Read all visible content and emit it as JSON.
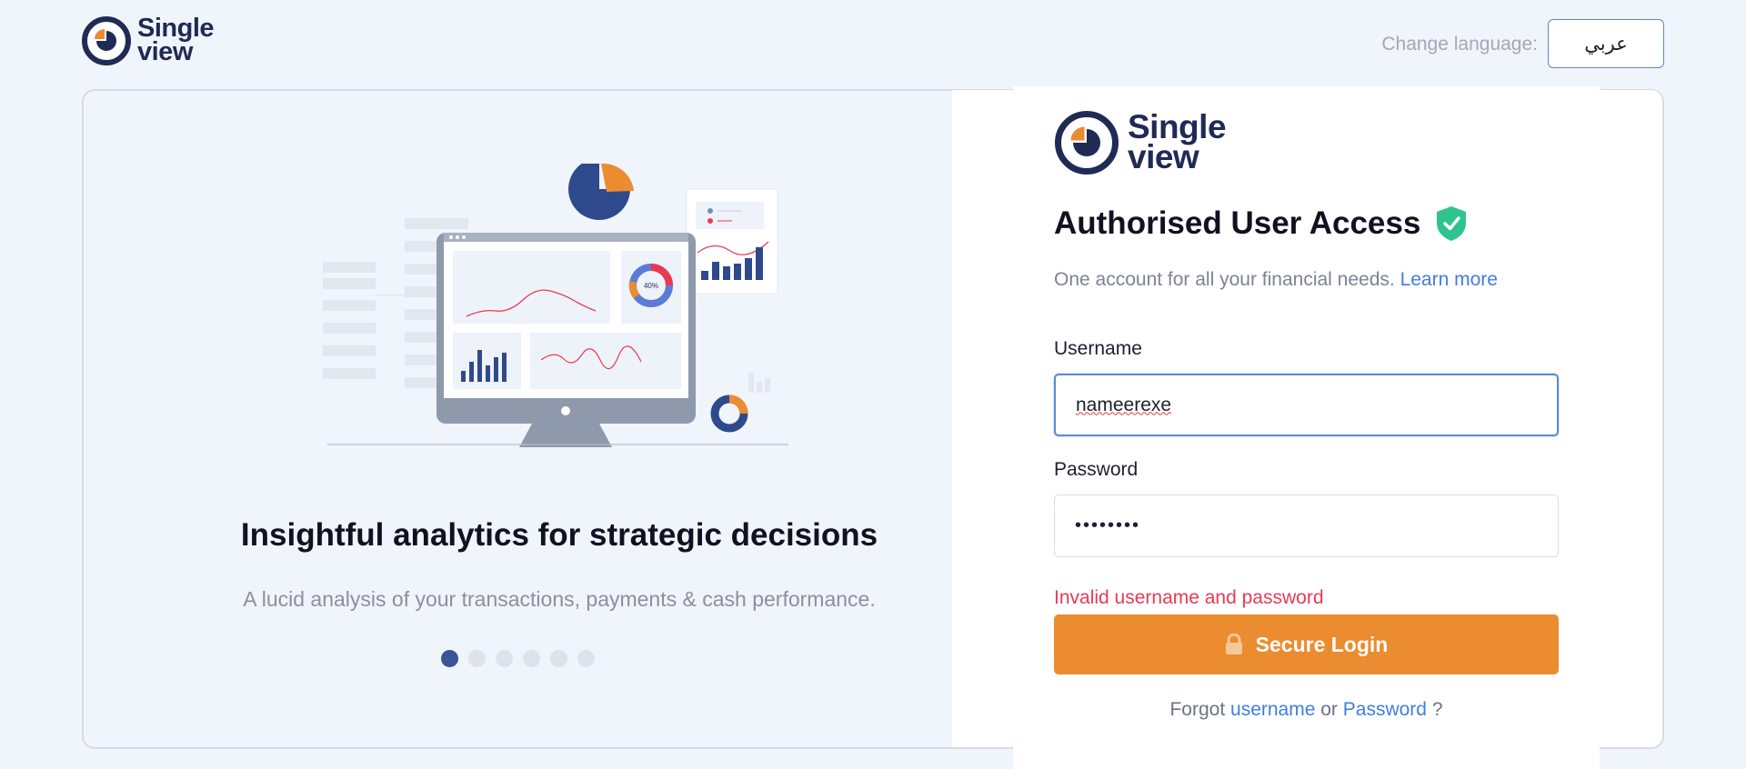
{
  "brand": {
    "line1": "Single",
    "line2": "view"
  },
  "header": {
    "change_language_label": "Change language:",
    "language_button": "عربي"
  },
  "carousel": {
    "title": "Insightful analytics for strategic decisions",
    "subtitle": "A lucid analysis of your transactions, payments & cash performance.",
    "slide_count": 6,
    "active_slide": 1,
    "illustration": {
      "donut_label": "40%"
    }
  },
  "login": {
    "heading": "Authorised User Access",
    "tagline": "One account for all your financial needs.",
    "learn_more": "Learn more",
    "username_label": "Username",
    "username_value": "nameerexe",
    "password_label": "Password",
    "password_value": "••••••••",
    "error": "Invalid username and password",
    "submit": "Secure Login",
    "forgot_prefix": "Forgot",
    "forgot_username": "username",
    "forgot_or": "or",
    "forgot_password": "Password",
    "forgot_suffix": "?"
  },
  "colors": {
    "brand_navy": "#1f2a55",
    "accent_orange": "#eb8c30",
    "link_blue": "#3f7ee4",
    "error_red": "#e83b52",
    "shield_green": "#2fc48d"
  },
  "icons": {
    "shield": "verified-shield-icon",
    "lock": "lock-icon"
  }
}
